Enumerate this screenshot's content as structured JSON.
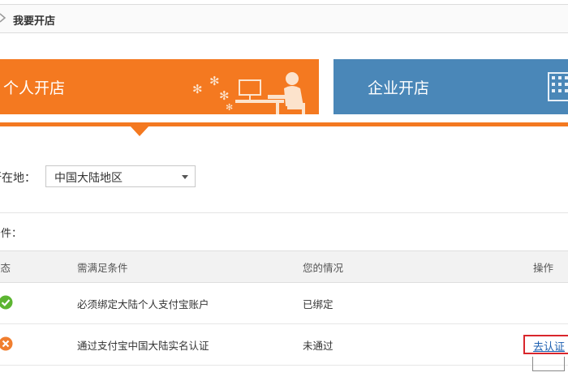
{
  "breadcrumb": {
    "title": "我要开店"
  },
  "shop_types": [
    {
      "label": "个人开店",
      "color": "#f47920",
      "selected": true,
      "icon": "person-at-desk-illustration"
    },
    {
      "label": "企业开店",
      "color": "#4a87b8",
      "selected": false,
      "icon": "building-icon"
    }
  ],
  "location": {
    "label": "所在地：",
    "selected": "中国大陆地区"
  },
  "conditions": {
    "label": "条件：",
    "headers": {
      "status": "状态",
      "requirement": "需满足条件",
      "situation": "您的情况",
      "action": "操作"
    },
    "rows": [
      {
        "status": "passed",
        "status_icon": "check-circle-icon",
        "status_color": "#5cb531",
        "requirement": "必须绑定大陆个人支付宝账户",
        "situation": "已绑定",
        "action": ""
      },
      {
        "status": "failed",
        "status_icon": "cross-circle-icon",
        "status_color": "#f07e2f",
        "requirement": "通过支付宝中国大陆实名认证",
        "situation": "未通过",
        "action": "去认证"
      }
    ]
  }
}
